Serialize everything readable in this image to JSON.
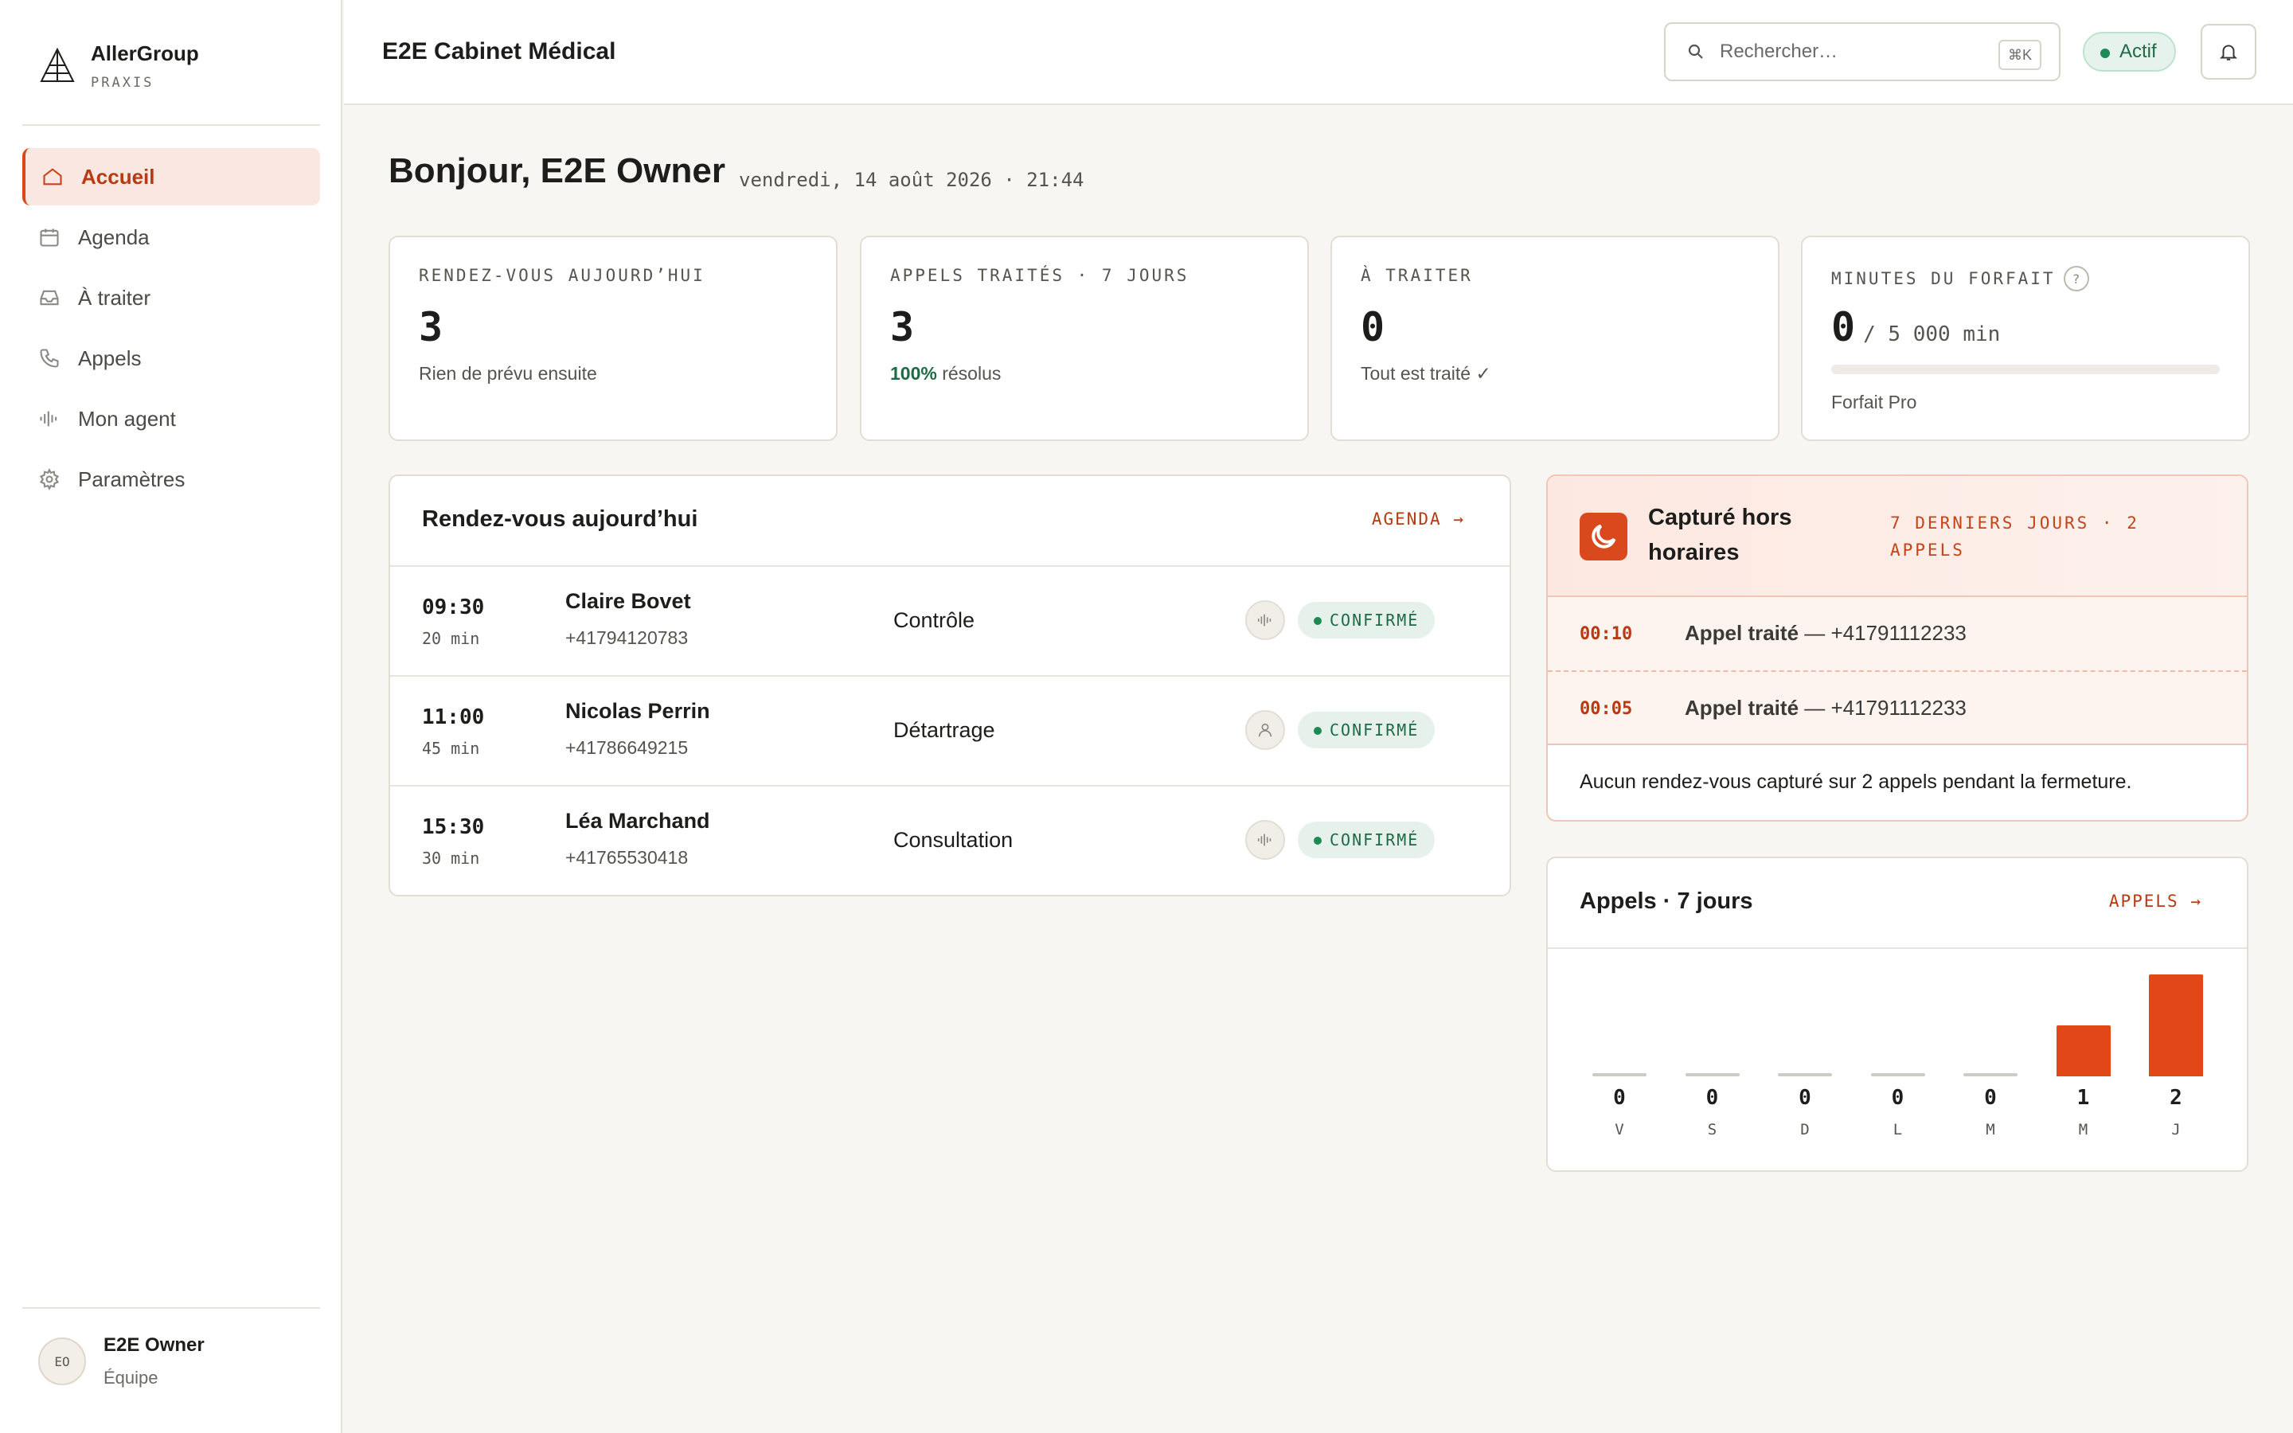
{
  "brand": {
    "name": "AllerGroup",
    "sub": "PRAXIS"
  },
  "nav": [
    {
      "label": "Accueil",
      "icon": "home-icon",
      "active": true
    },
    {
      "label": "Agenda",
      "icon": "calendar-icon"
    },
    {
      "label": "À traiter",
      "icon": "inbox-icon"
    },
    {
      "label": "Appels",
      "icon": "phone-icon"
    },
    {
      "label": "Mon agent",
      "icon": "waveform-icon"
    },
    {
      "label": "Paramètres",
      "icon": "gear-icon"
    }
  ],
  "user": {
    "initials": "EO",
    "name": "E2E Owner",
    "role": "Équipe"
  },
  "topbar": {
    "title": "E2E Cabinet Médical",
    "search_placeholder": "Rechercher…",
    "search_shortcut": "⌘K",
    "status": "Actif"
  },
  "greeting": {
    "text": "Bonjour, E2E Owner",
    "date": "vendredi, 14 août 2026 · 21:44"
  },
  "stats": {
    "rdv": {
      "label": "RENDEZ-VOUS AUJOURD’HUI",
      "value": "3",
      "sub": "Rien de prévu ensuite"
    },
    "calls": {
      "label": "APPELS TRAITÉS · 7 JOURS",
      "value": "3",
      "sub_pct": "100%",
      "sub_text": "résolus"
    },
    "todo": {
      "label": "À TRAITER",
      "value": "0",
      "sub": "Tout est traité ✓"
    },
    "quota": {
      "label": "MINUTES DU FORFAIT",
      "help": "?",
      "value": "0",
      "total": "/ 5 000 min",
      "used_fraction": 0,
      "plan": "Forfait Pro"
    }
  },
  "appointments": {
    "title": "Rendez-vous aujourd’hui",
    "link": "AGENDA →",
    "items": [
      {
        "time": "09:30",
        "duration": "20 min",
        "name": "Claire Bovet",
        "phone": "+41794120783",
        "type": "Contrôle",
        "icon": "waveform-icon",
        "status": "CONFIRMÉ"
      },
      {
        "time": "11:00",
        "duration": "45 min",
        "name": "Nicolas Perrin",
        "phone": "+41786649215",
        "type": "Détartrage",
        "icon": "person-icon",
        "status": "CONFIRMÉ"
      },
      {
        "time": "15:30",
        "duration": "30 min",
        "name": "Léa Marchand",
        "phone": "+41765530418",
        "type": "Consultation",
        "icon": "waveform-icon",
        "status": "CONFIRMÉ"
      }
    ]
  },
  "after_hours": {
    "title": "Capturé hors horaires",
    "meta": "7 DERNIERS JOURS · 2 APPELS",
    "rows": [
      {
        "time": "00:10",
        "label": "Appel traité",
        "rest": " — +41791112233"
      },
      {
        "time": "00:05",
        "label": "Appel traité",
        "rest": " — +41791112233"
      }
    ],
    "footer": "Aucun rendez-vous capturé sur 2 appels pendant la fermeture."
  },
  "calls_chart": {
    "title": "Appels · 7 jours",
    "link": "APPELS →"
  },
  "chart_data": {
    "type": "bar",
    "categories": [
      "V",
      "S",
      "D",
      "L",
      "M",
      "M",
      "J"
    ],
    "values": [
      0,
      0,
      0,
      0,
      0,
      1,
      2
    ],
    "color": "#e14717"
  },
  "colors": {
    "accent": "#d9491d",
    "success": "#1e8a55"
  }
}
